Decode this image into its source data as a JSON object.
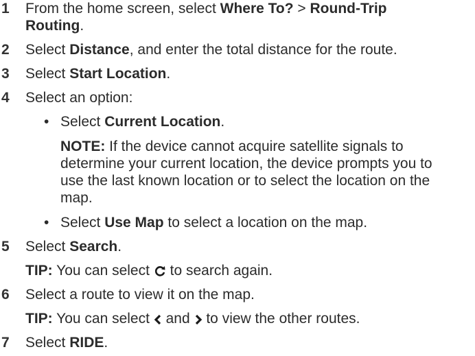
{
  "steps": [
    {
      "number": "1",
      "line1_before": "From the home screen, select ",
      "where_to": "Where To?",
      "sep": " > ",
      "round_trip": "Round-Trip",
      "line2": "Routing",
      "line2_after": "."
    },
    {
      "number": "2",
      "before": "Select ",
      "bold": "Distance",
      "after": ", and enter the total distance for the route."
    },
    {
      "number": "3",
      "before": "Select ",
      "bold": "Start Location",
      "after": "."
    },
    {
      "number": "4",
      "text": "Select an option:",
      "bullets": [
        {
          "before": "Select ",
          "bold": "Current Location",
          "after": ".",
          "note_label": "NOTE:",
          "note_lines": [
            " If the device cannot acquire satellite signals to",
            "determine your current location, the device prompts you to",
            "use the last known location or to select the location on the",
            "map."
          ]
        },
        {
          "before": "Select ",
          "bold": "Use Map",
          "after": " to select a location on the map."
        }
      ]
    },
    {
      "number": "5",
      "before": "Select ",
      "bold": "Search",
      "after": ".",
      "tip_label": "TIP:",
      "tip_before": " You can select ",
      "tip_icon": "refresh-icon",
      "tip_after": " to search again."
    },
    {
      "number": "6",
      "text": "Select a route to view it on the map.",
      "tip_label": "TIP:",
      "tip_before": " You can select ",
      "tip_icon_left": "chevron-left-icon",
      "tip_mid": " and ",
      "tip_icon_right": "chevron-right-icon",
      "tip_after": " to view the other routes."
    },
    {
      "number": "7",
      "before": "Select ",
      "bold": "RIDE",
      "after": "."
    }
  ]
}
